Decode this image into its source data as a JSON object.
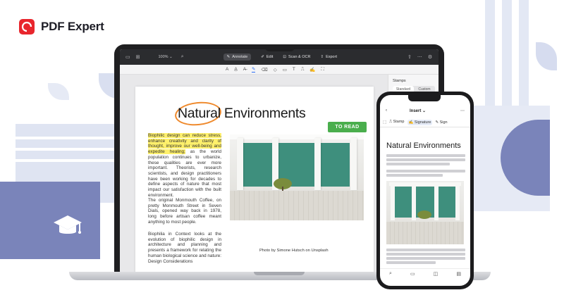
{
  "brand": {
    "name": "PDF Expert",
    "logo_text": "PDF"
  },
  "toolbar": {
    "zoom": "100% ⌄",
    "modes": [
      {
        "label": "Annotate",
        "active": true
      },
      {
        "label": "Edit",
        "active": false
      },
      {
        "label": "Scan & OCR",
        "active": false
      },
      {
        "label": "Export",
        "active": false
      }
    ]
  },
  "document": {
    "title": "Natural Environments",
    "sticker": "TO READ",
    "highlighted_text": "Biophilic design can reduce stress, enhance creativity and clarity of thought, improve our well-being and expedite healing;",
    "p1_rest": " as the world population continues to urbanize, these qualities are ever more important. Theorists, research scientists, and design practitioners have been working for decades to define aspects of nature that most impact our satisfaction with the built environment.",
    "p2": "The original Monmouth Coffee, on pretty Monmouth Street in Seven Dials, opened way back in 1978, long before artisan coffee meant anything to most people.",
    "p3": "Biophilia in Context looks at the evolution of biophilic design in architecture and planning and presents a framework for relating the human biological science and nature: Design Considerations",
    "caption": "Photo by Simone Hutsch on Unsplash"
  },
  "side_panel": {
    "title": "Stamps",
    "tabs": [
      "Standard",
      "Custom"
    ]
  },
  "phone": {
    "mode": "Insert",
    "tools": [
      "Stamp",
      "Signature",
      "Sign"
    ],
    "title": "Natural Environments"
  },
  "colors": {
    "brand_red": "#e8262d",
    "highlight": "#fff06b",
    "sticker_green": "#4aae4d",
    "circle_orange": "#ef8a2d",
    "accent_blue": "#2a6df4"
  }
}
